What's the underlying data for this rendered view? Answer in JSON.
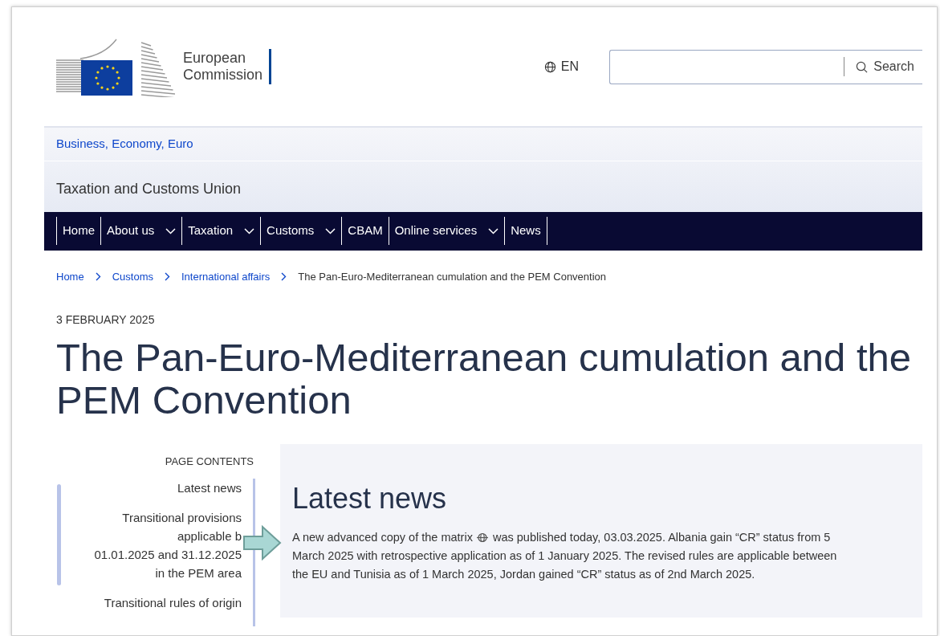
{
  "header": {
    "logo_text": [
      "European",
      "Commission"
    ],
    "language": "EN",
    "search": {
      "button": "Search"
    }
  },
  "site": {
    "parent_link": "Business, Economy, Euro",
    "title": "Taxation and Customs Union"
  },
  "nav": [
    {
      "label": "Home",
      "has_dropdown": false
    },
    {
      "label": "About us",
      "has_dropdown": true
    },
    {
      "label": "Taxation",
      "has_dropdown": true
    },
    {
      "label": "Customs",
      "has_dropdown": true
    },
    {
      "label": "CBAM",
      "has_dropdown": false
    },
    {
      "label": "Online services",
      "has_dropdown": true
    },
    {
      "label": "News",
      "has_dropdown": false
    }
  ],
  "breadcrumb": [
    {
      "label": "Home",
      "current": false
    },
    {
      "label": "Customs",
      "current": false
    },
    {
      "label": "International affairs",
      "current": false
    },
    {
      "label": "The Pan-Euro-Mediterranean cumulation and the PEM Convention",
      "current": true
    }
  ],
  "date": "3 FEBRUARY 2025",
  "page_title": "The Pan-Euro-Mediterranean cumulation and the PEM Convention",
  "page_contents": {
    "heading": "PAGE CONTENTS",
    "items": [
      {
        "lines": [
          "Latest news"
        ]
      },
      {
        "lines": [
          "Transitional provisions",
          "applicable b",
          "01.01.2025 and 31.12.2025",
          "in the PEM area"
        ]
      },
      {
        "lines": [
          "Transitional rules of origin"
        ]
      }
    ]
  },
  "section": {
    "heading": "Latest news",
    "paragraph": {
      "before": "A ",
      "link": "new advanced copy of the matrix",
      "after": " was published today, 03.03.2025. Albania gain “CR” status from 5 March 2025 with retrospective application as of 1 January 2025. The revised rules are applicable between the EU and Tunisia as of 1 March 2025, Jordan gained “CR” status as of 2nd March 2025."
    }
  }
}
